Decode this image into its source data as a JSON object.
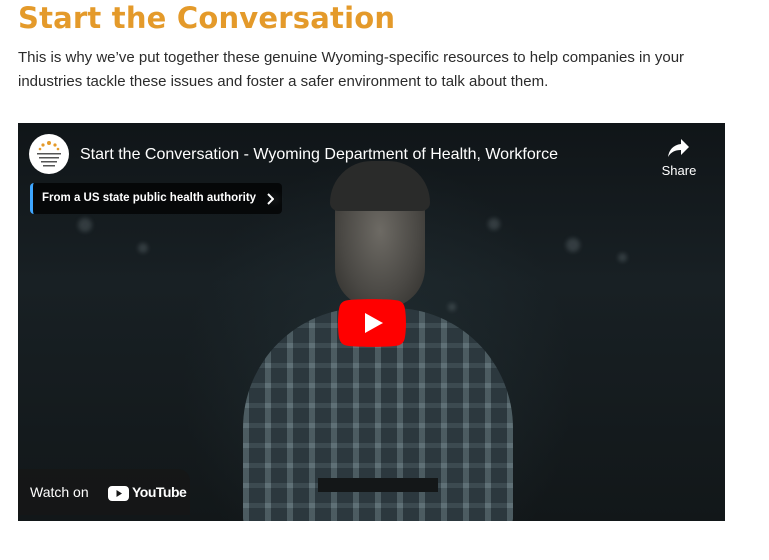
{
  "section": {
    "heading": "Start the Conversation",
    "intro": "This is why we’ve put together these genuine Wyoming-specific resources to help companies in your industries tackle these issues and foster a safer environment to talk about them."
  },
  "video": {
    "title": "Start the Conversation - Wyoming Department of Health, Workforce",
    "channel_logo_text": "Wyoming Department of Health",
    "authority_label": "From a US state public health authority",
    "share_label": "Share",
    "watch_on_label": "Watch on",
    "youtube_wordmark": "YouTube",
    "colors": {
      "heading": "#e49a2a",
      "play_button": "#ff0000",
      "authority_accent": "#3ea6ff"
    },
    "icons": [
      "channel-logo",
      "share-arrow-icon",
      "chevron-right-icon",
      "play-icon",
      "youtube-logo-icon"
    ]
  }
}
